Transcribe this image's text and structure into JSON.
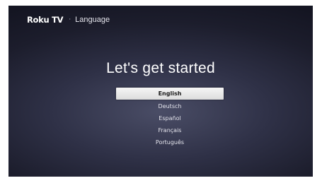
{
  "header": {
    "brand": "Roku TV",
    "separator": "·",
    "screen_name": "Language"
  },
  "main": {
    "title": "Let's get started",
    "languages": [
      {
        "label": "English",
        "selected": true
      },
      {
        "label": "Deutsch",
        "selected": false
      },
      {
        "label": "Español",
        "selected": false
      },
      {
        "label": "Français",
        "selected": false
      },
      {
        "label": "Português",
        "selected": false
      }
    ]
  },
  "colors": {
    "background_center": "#4a4d66",
    "background_edge": "#141522",
    "selection_highlight": "#eeeeee",
    "selected_text": "#1a1a1a",
    "text": "#ffffff"
  }
}
